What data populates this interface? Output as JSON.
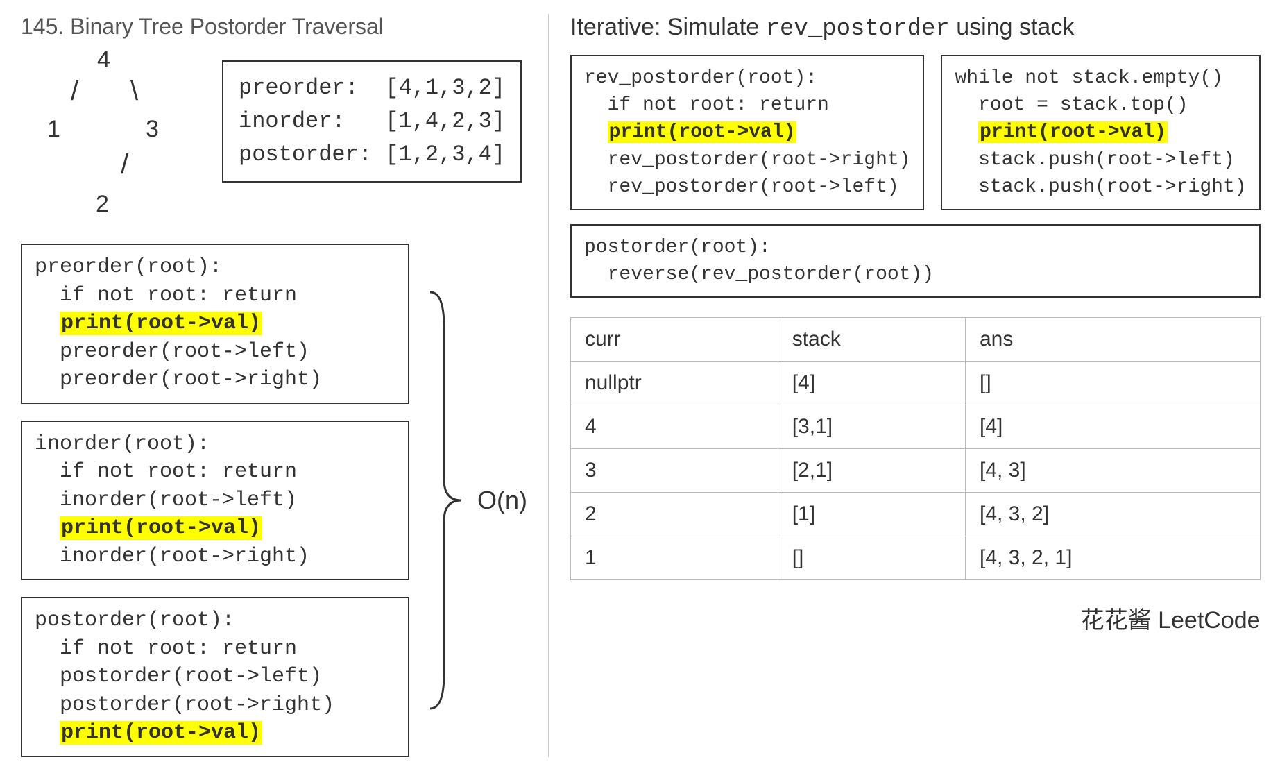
{
  "title": "145. Binary Tree Postorder Traversal",
  "tree": {
    "n4": "4",
    "n1": "1",
    "n3": "3",
    "n2": "2",
    "edge_l": "/",
    "edge_r": "\\"
  },
  "orders": {
    "pre_label": "preorder:  ",
    "pre_val": "[4,1,3,2]",
    "in_label": "inorder:   ",
    "in_val": "[1,4,2,3]",
    "post_label": "postorder: ",
    "post_val": "[1,2,3,4]"
  },
  "preorder": {
    "l1": "preorder(root):",
    "l2": "  if not root: return",
    "hl": "print(root->val)",
    "l4": "  preorder(root->left)",
    "l5": "  preorder(root->right)"
  },
  "inorder": {
    "l1": "inorder(root):",
    "l2": "  if not root: return",
    "l3": "  inorder(root->left)",
    "hl": "print(root->val)",
    "l5": "  inorder(root->right)"
  },
  "postorder_rec": {
    "l1": "postorder(root):",
    "l2": "  if not root: return",
    "l3": "  postorder(root->left)",
    "l4": "  postorder(root->right)",
    "hl": "print(root->val)"
  },
  "bigO": "O(n)",
  "iter_title_a": "Iterative: Simulate ",
  "iter_title_mono": "rev_postorder",
  "iter_title_b": " using stack",
  "rev_postorder": {
    "l1": "rev_postorder(root):",
    "l2": "  if not root: return",
    "hl": "print(root->val)",
    "l4": "  rev_postorder(root->right)",
    "l5": "  rev_postorder(root->left)"
  },
  "stack_loop": {
    "l1": "while not stack.empty()",
    "l2": "  root = stack.top()",
    "hl": "print(root->val)",
    "l4": "  stack.push(root->left)",
    "l5": "  stack.push(root->right)"
  },
  "postorder_wrap": {
    "l1": "postorder(root):",
    "l2": "  reverse(rev_postorder(root))"
  },
  "table": {
    "headers": [
      "curr",
      "stack",
      "ans"
    ],
    "rows": [
      [
        "nullptr",
        "[4]",
        "[]"
      ],
      [
        "4",
        "[3,1]",
        "[4]"
      ],
      [
        "3",
        "[2,1]",
        "[4, 3]"
      ],
      [
        "2",
        "[1]",
        "[4, 3, 2]"
      ],
      [
        "1",
        "[]",
        "[4, 3, 2, 1]"
      ]
    ]
  },
  "footer": "花花酱 LeetCode"
}
